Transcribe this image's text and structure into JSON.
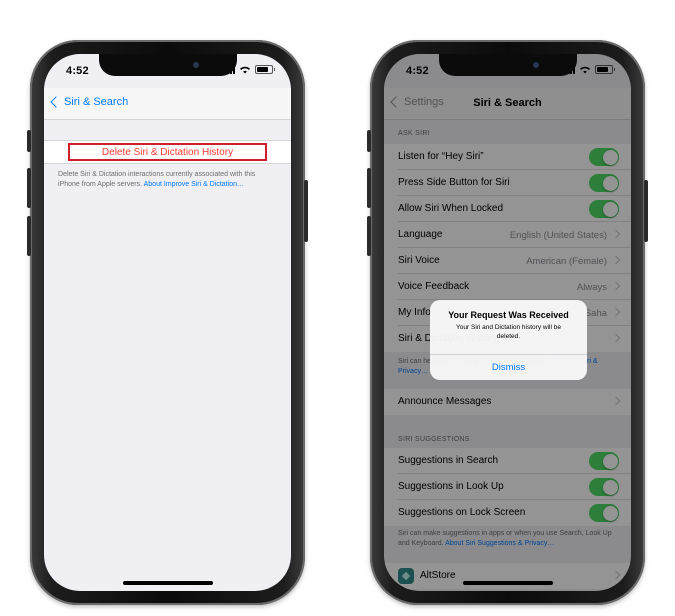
{
  "left_phone": {
    "status": {
      "time": "4:52"
    },
    "nav": {
      "back_label": "Siri & Search"
    },
    "delete_button_label": "Delete Siri & Dictation History",
    "note_text": "Delete Siri & Dictation interactions currently associated with this iPhone from Apple servers. ",
    "note_link": "About Improve Siri & Dictation…"
  },
  "right_phone": {
    "status": {
      "time": "4:52"
    },
    "nav": {
      "back_label": "Settings",
      "title": "Siri & Search"
    },
    "ask_siri_header": "ASK SIRI",
    "ask_siri_items": [
      {
        "label": "Listen for “Hey Siri”",
        "toggle_on": true
      },
      {
        "label": "Press Side Button for Siri",
        "toggle_on": true
      },
      {
        "label": "Allow Siri When Locked",
        "toggle_on": true
      },
      {
        "label": "Language",
        "value": "English (United States)"
      },
      {
        "label": "Siri Voice",
        "value": "American (Female)"
      },
      {
        "label": "Voice Feedback",
        "value": "Always"
      },
      {
        "label": "My Info",
        "value": "Saha"
      },
      {
        "label": "Siri & Dictation History"
      }
    ],
    "ask_siri_footer_text": "Siri can help you get things done just by asking. ",
    "ask_siri_footer_link": "About Ask Siri & Privacy…",
    "announce_messages_label": "Announce Messages",
    "suggestions_header": "SIRI SUGGESTIONS",
    "suggestion_items": [
      {
        "label": "Suggestions in Search",
        "toggle_on": true
      },
      {
        "label": "Suggestions in Look Up",
        "toggle_on": true
      },
      {
        "label": "Suggestions on Lock Screen",
        "toggle_on": true
      }
    ],
    "suggestions_footer_text": "Siri can make suggestions in apps or when you use Search, Look Up and Keyboard. ",
    "suggestions_footer_link": "About Siri Suggestions & Privacy…",
    "app_row_label": "AltStore",
    "alert": {
      "title": "Your Request Was Received",
      "message": "Your Siri and Dictation history will be deleted.",
      "button": "Dismiss"
    }
  },
  "colors": {
    "accent_blue": "#007aff",
    "destructive_red": "#ff3b30",
    "highlight_red": "#d01f2b",
    "toggle_green": "#4cd964"
  }
}
